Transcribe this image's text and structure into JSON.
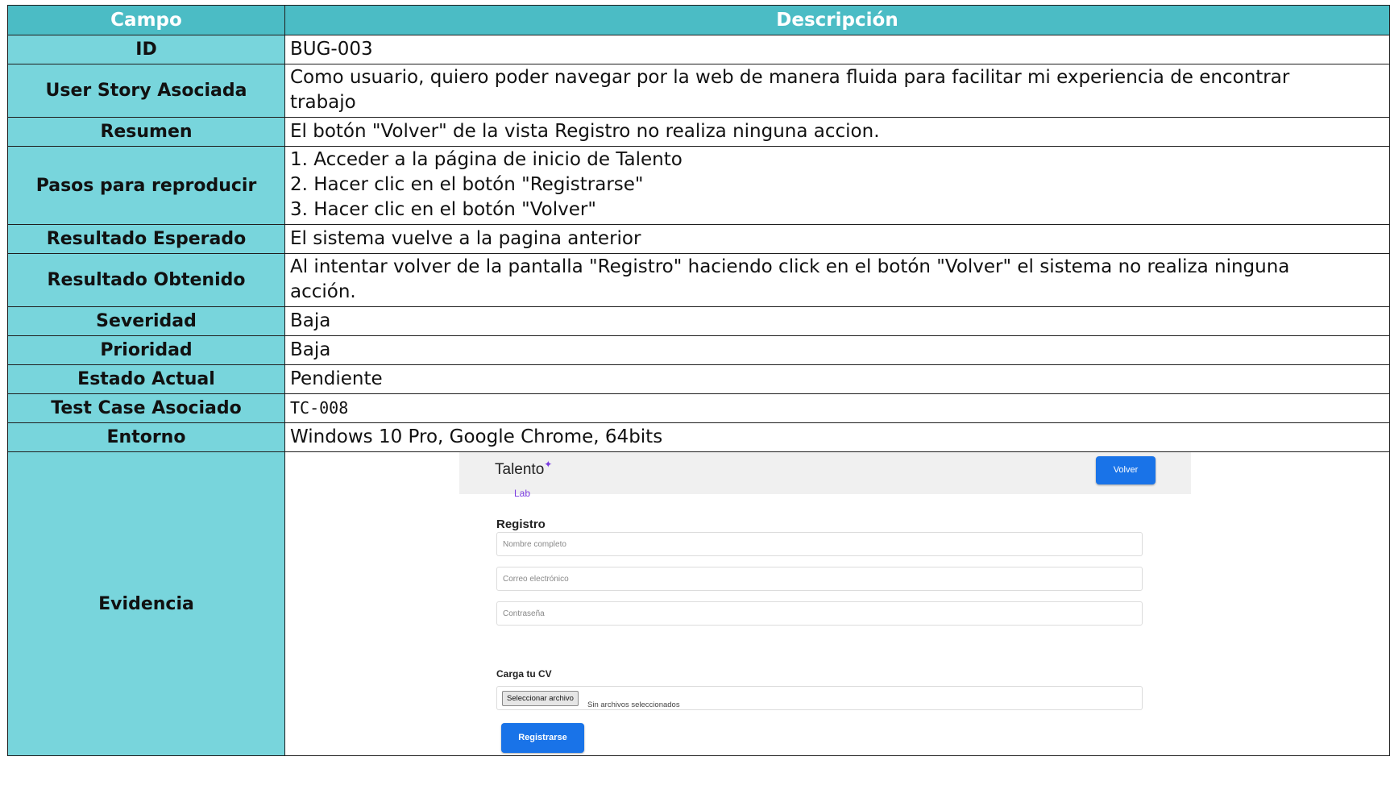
{
  "table": {
    "header": {
      "field": "Campo",
      "description": "Descripción"
    },
    "rows": [
      {
        "key": "ID",
        "value": "BUG-003"
      },
      {
        "key": "User Story Asociada",
        "lines": [
          "Como usuario, quiero poder navegar por la web de manera fluida para facilitar mi experiencia de encontrar",
          "trabajo"
        ]
      },
      {
        "key": "Resumen",
        "value": "El botón \"Volver\" de la vista Registro no realiza ninguna accion."
      },
      {
        "key": "Pasos para reproducir",
        "lines": [
          "1. Acceder a la página de inicio de Talento",
          "2. Hacer clic en el botón \"Registrarse\"",
          "3. Hacer clic en el botón \"Volver\""
        ]
      },
      {
        "key": "Resultado Esperado",
        "value": "El sistema vuelve a la pagina anterior"
      },
      {
        "key": "Resultado Obtenido",
        "lines": [
          "Al intentar volver de la pantalla \"Registro\" haciendo click en el botón \"Volver\" el sistema no realiza ninguna",
          "acción."
        ]
      },
      {
        "key": "Severidad",
        "value": "Baja"
      },
      {
        "key": "Prioridad",
        "value": "Baja"
      },
      {
        "key": "Estado Actual",
        "value": "Pendiente"
      },
      {
        "key": "Test Case Asociado",
        "value": "TC-008"
      },
      {
        "key": "Entorno",
        "value": "Windows 10 Pro, Google Chrome, 64bits"
      },
      {
        "key": "Evidencia"
      }
    ]
  },
  "evidence": {
    "logo": {
      "name": "Talento",
      "sub": "Lab",
      "icon": "sparkle-icon"
    },
    "back_button": "Volver",
    "form_title": "Registro",
    "fields": {
      "name_placeholder": "Nombre completo",
      "email_placeholder": "Correo electrónico",
      "password_placeholder": "Contraseña"
    },
    "cv_label": "Carga tu CV",
    "file_button": "Seleccionar archivo",
    "file_status": "Sin archivos seleccionados",
    "submit_button": "Registrarse",
    "colors": {
      "primary": "#1973e8",
      "accent": "#7a3be0"
    }
  },
  "colors": {
    "header_bg": "#4bbcc5",
    "key_bg": "#78d5dc"
  }
}
